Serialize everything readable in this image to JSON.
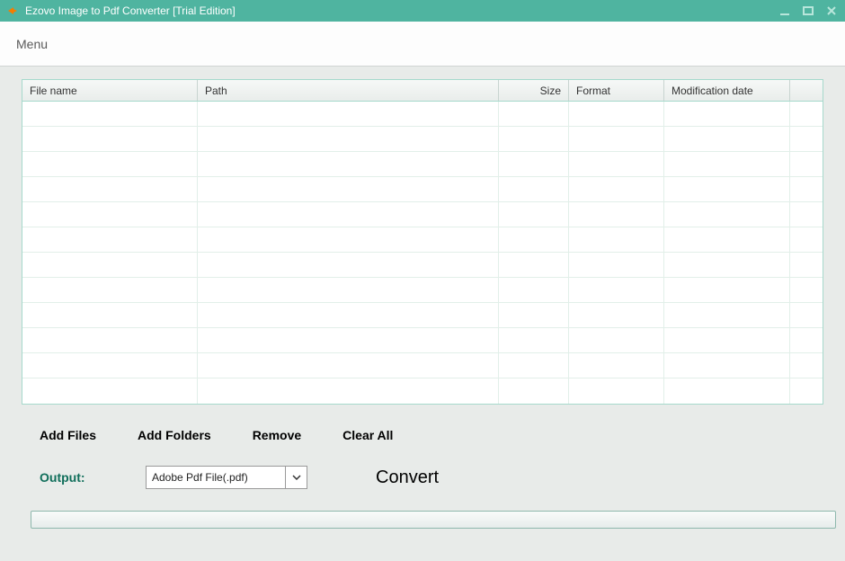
{
  "titlebar": {
    "title": "Ezovo Image to Pdf Converter [Trial Edition]"
  },
  "menubar": {
    "menu_label": "Menu"
  },
  "table": {
    "columns": {
      "name": "File name",
      "path": "Path",
      "size": "Size",
      "format": "Format",
      "date": "Modification date"
    }
  },
  "toolbar": {
    "add_files": "Add Files",
    "add_folders": "Add Folders",
    "remove": "Remove",
    "clear_all": "Clear All"
  },
  "output": {
    "label": "Output:",
    "selected": "Adobe Pdf File(.pdf)"
  },
  "convert": {
    "label": "Convert"
  }
}
